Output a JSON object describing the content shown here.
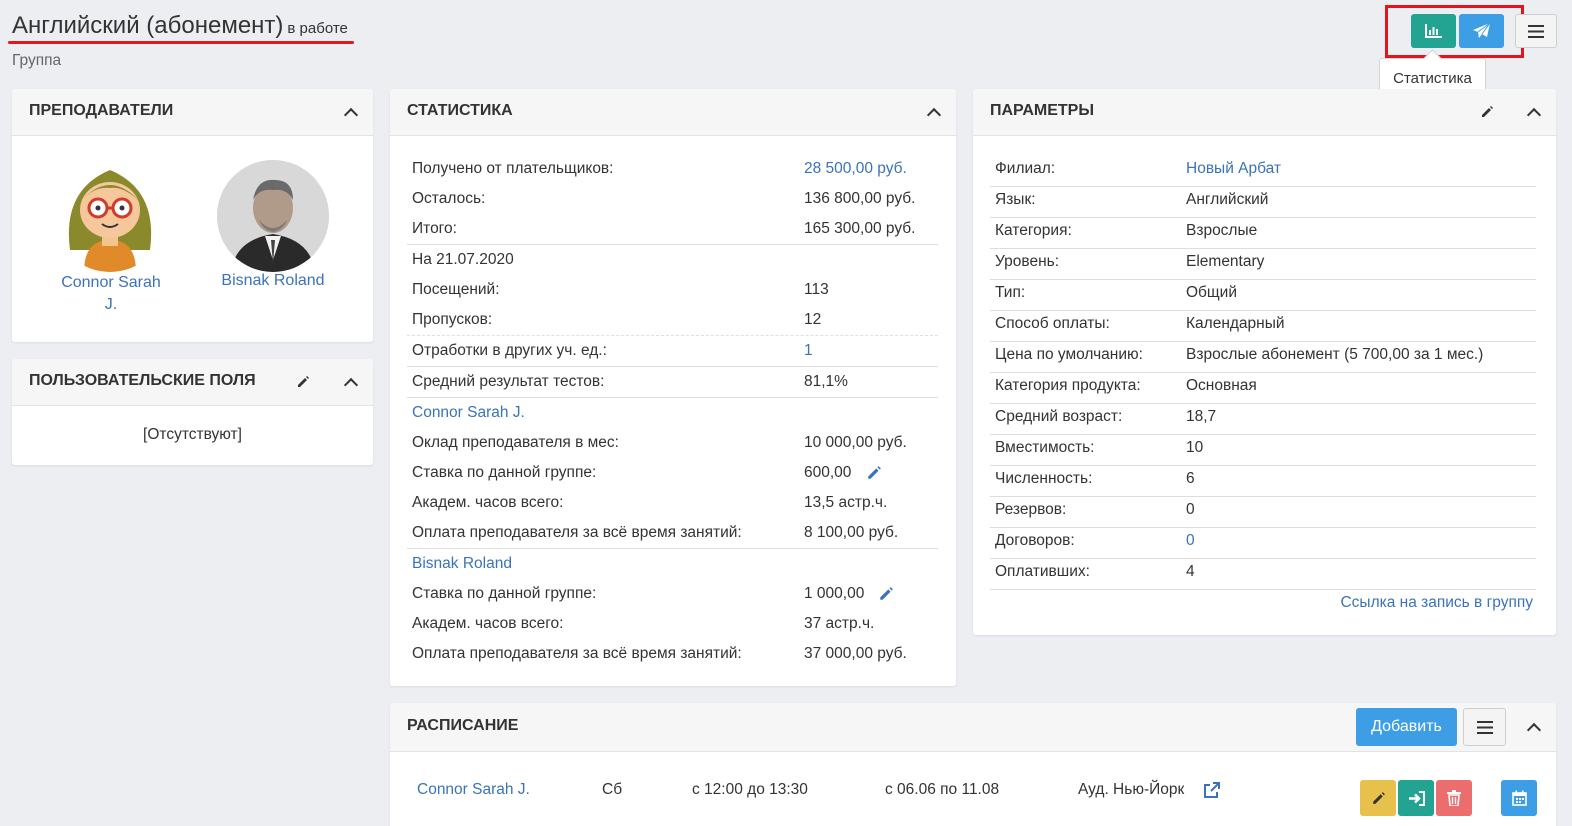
{
  "header": {
    "title": "Английский (абонемент)",
    "status": "в работе",
    "subtitle": "Группа",
    "tooltip": "Статистика",
    "icons": [
      "bar-chart-icon",
      "paper-plane-icon",
      "hamburger-menu-icon"
    ]
  },
  "teachers_panel": {
    "title": "Преподаватели",
    "teachers": [
      {
        "name": "Connor Sarah J."
      },
      {
        "name": "Bisnak Roland"
      }
    ]
  },
  "custom_fields_panel": {
    "title": "Пользовательские поля",
    "empty_text": "[Отсутствуют]"
  },
  "stats_panel": {
    "title": "Статистика",
    "received_label": "Получено от плательщиков:",
    "received_value": "28 500,00 руб.",
    "remaining_label": "Осталось:",
    "remaining_value": "136 800,00 руб.",
    "total_label": "Итого:",
    "total_value": "165 300,00 руб.",
    "date_label": "На 21.07.2020",
    "visits_label": "Посещений:",
    "visits_value": "113",
    "absences_label": "Пропусков:",
    "absences_value": "12",
    "makeups_label": "Отработки в других уч. ед.:",
    "makeups_value": "1",
    "avg_test_label": "Средний результат тестов:",
    "avg_test_value": "81,1%",
    "teacher1": {
      "name": "Connor Sarah J.",
      "salary_label": "Оклад преподавателя в мес:",
      "salary_value": "10 000,00 руб.",
      "rate_label": "Ставка по данной группе:",
      "rate_value": "600,00",
      "hours_label": "Академ. часов всего:",
      "hours_value": "13,5 астр.ч.",
      "pay_label": "Оплата преподавателя за всё время занятий:",
      "pay_value": "8 100,00 руб."
    },
    "teacher2": {
      "name": "Bisnak Roland",
      "rate_label": "Ставка по данной группе:",
      "rate_value": "1 000,00",
      "hours_label": "Академ. часов всего:",
      "hours_value": "37 астр.ч.",
      "pay_label": "Оплата преподавателя за всё время занятий:",
      "pay_value": "37 000,00 руб."
    }
  },
  "params_panel": {
    "title": "Параметры",
    "rows": [
      {
        "label": "Филиал:",
        "value": "Новый Арбат"
      },
      {
        "label": "Язык:",
        "value": "Английский"
      },
      {
        "label": "Категория:",
        "value": "Взрослые"
      },
      {
        "label": "Уровень:",
        "value": "Elementary"
      },
      {
        "label": "Тип:",
        "value": "Общий"
      },
      {
        "label": "Способ оплаты:",
        "value": "Календарный"
      },
      {
        "label": "Цена по умолчанию:",
        "value": "Взрослые абонемент (5 700,00 за 1 мес.)"
      },
      {
        "label": "Категория продукта:",
        "value": "Основная"
      },
      {
        "label": "Средний возраст:",
        "value": "18,7"
      },
      {
        "label": "Вместимость:",
        "value": "10"
      },
      {
        "label": "Численность:",
        "value": "6"
      },
      {
        "label": "Резервов:",
        "value": "0"
      },
      {
        "label": "Договоров:",
        "value": "0"
      },
      {
        "label": "Оплативших:",
        "value": "4"
      }
    ],
    "signup_link": "Ссылка на запись в группу"
  },
  "schedule_panel": {
    "title": "Расписание",
    "add_label": "Добавить",
    "item": {
      "teacher": "Connor Sarah J.",
      "day": "Сб",
      "time": "с 12:00 до 13:30",
      "period": "с 06.06 по 11.08",
      "room": "Ауд. Нью-Йорк"
    }
  },
  "colors": {
    "accent_teal": "#23a493",
    "accent_blue": "#3d9ee6",
    "link": "#3a73b8",
    "highlight_red": "#e3141b",
    "warning_yellow": "#e8c04c",
    "danger_red": "#ec6d6d"
  }
}
